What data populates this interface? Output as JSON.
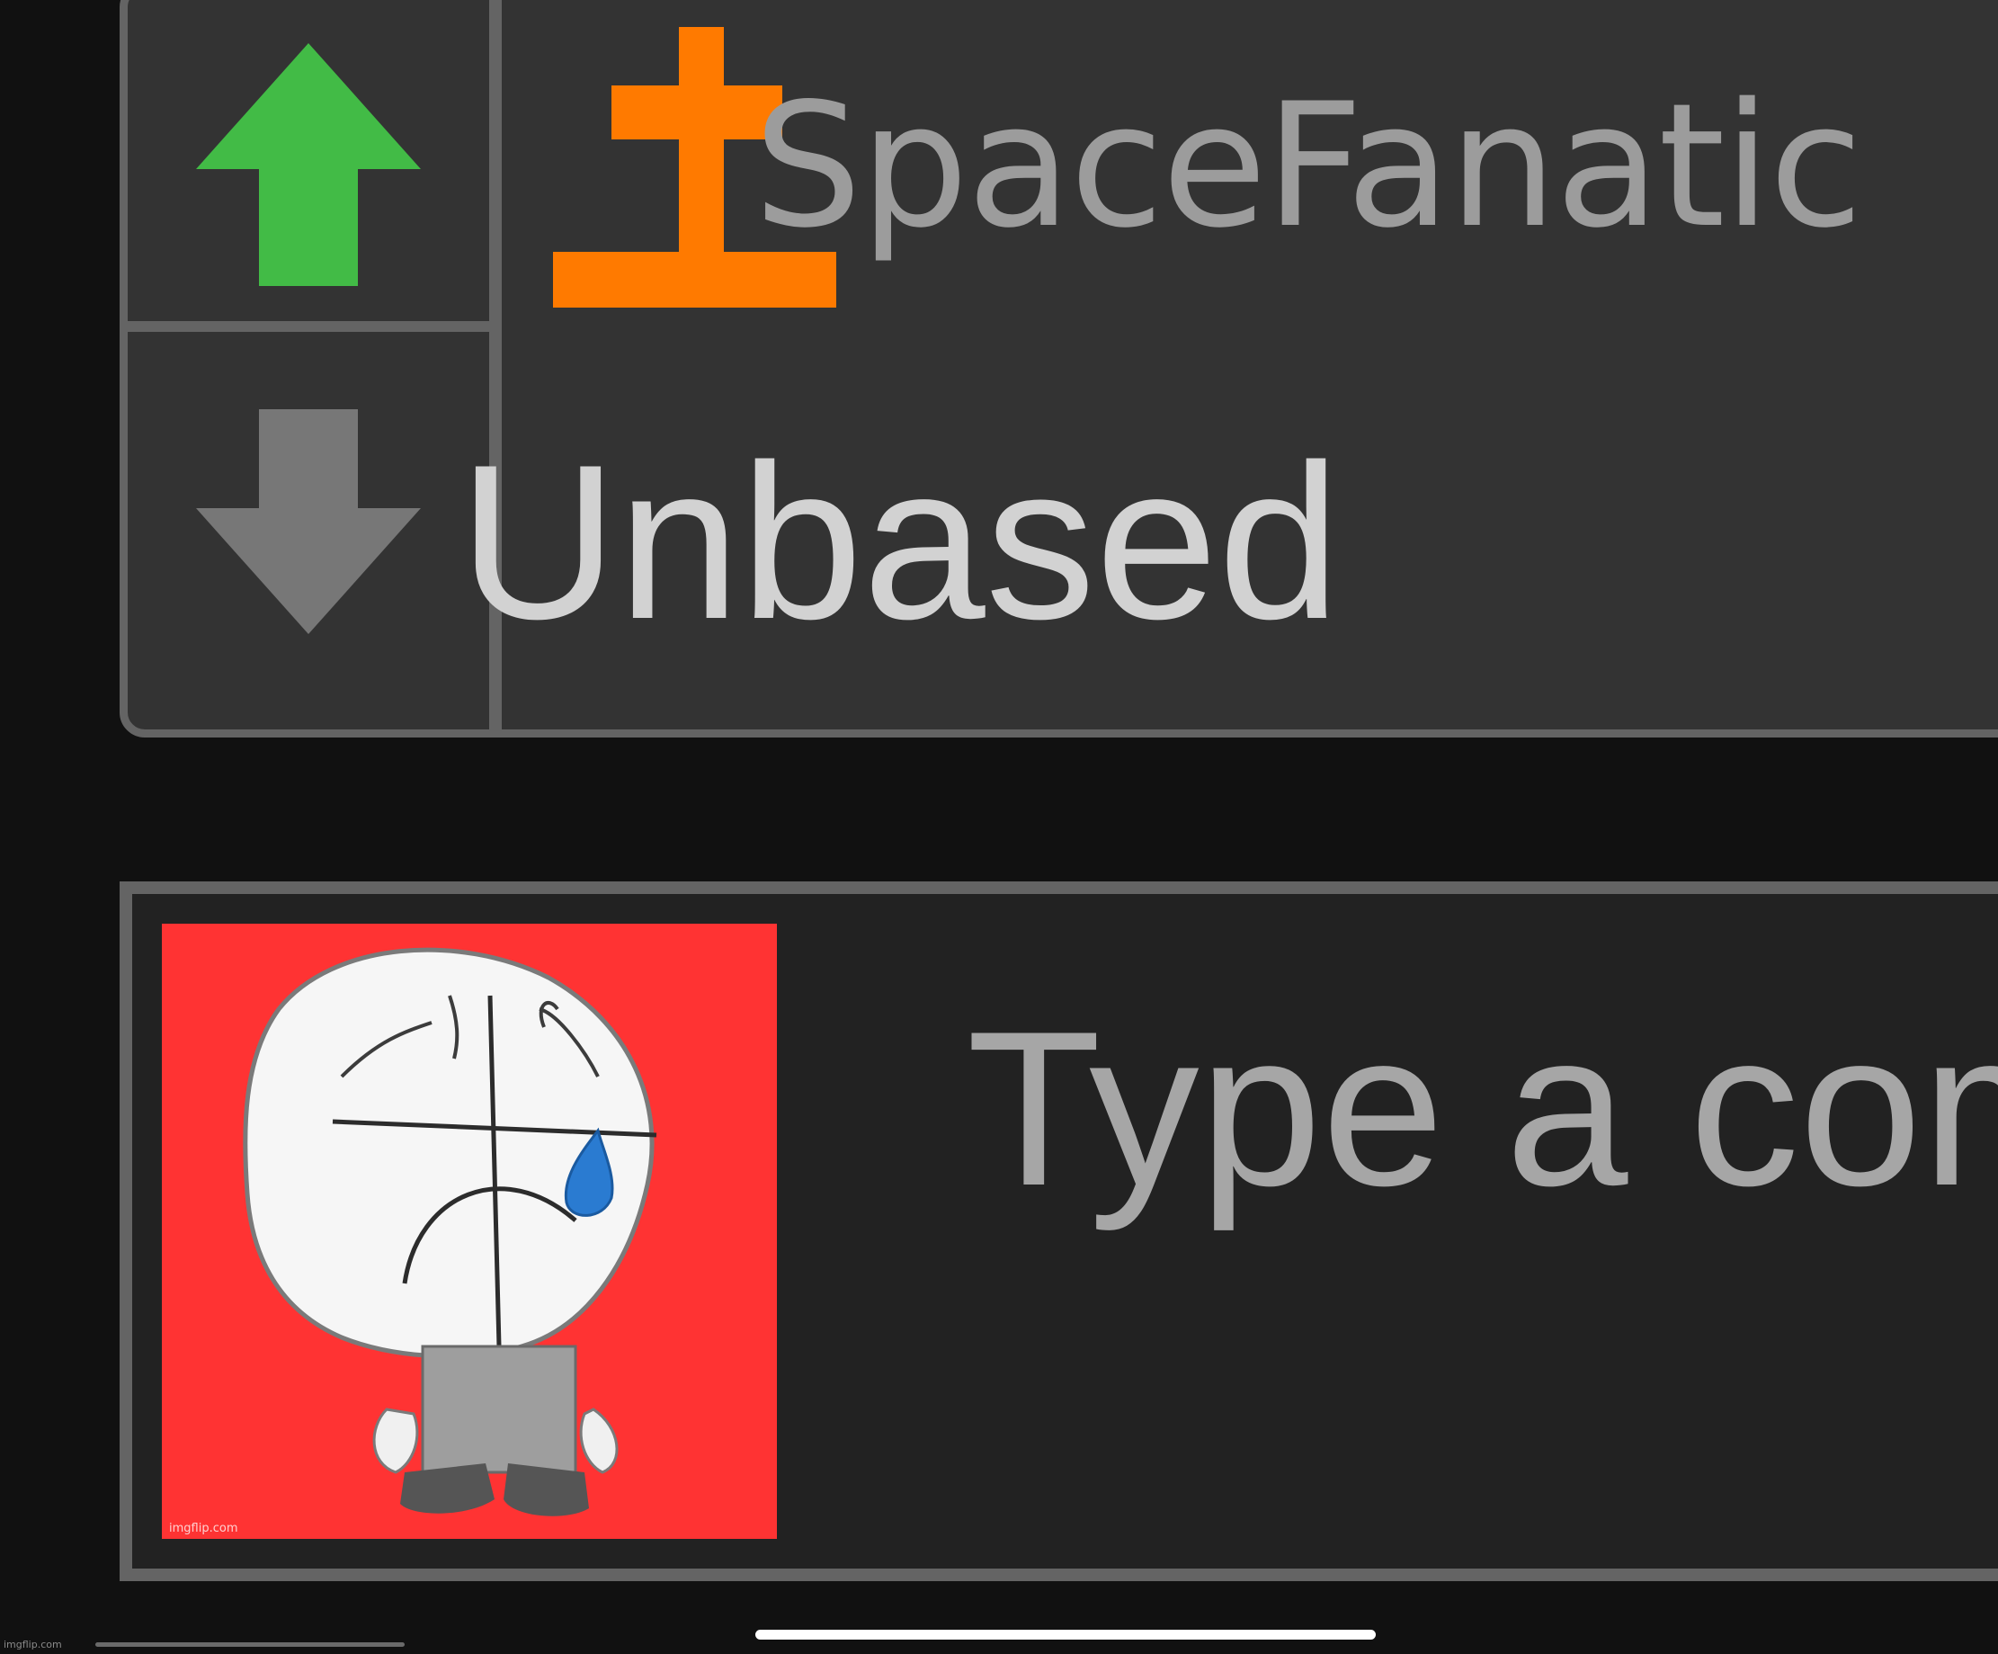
{
  "comment": {
    "username": "SpaceFanatic",
    "text": "Unbased",
    "vote_state": "upvoted"
  },
  "icons": {
    "upvote": "arrow-up-icon",
    "downvote": "arrow-down-icon",
    "user_badge": "flag-user-icon"
  },
  "colors": {
    "upvote_active": "#42bb46",
    "downvote_inactive": "#777777",
    "user_badge": "#ff7a00",
    "avatar_background": "#ff3333"
  },
  "reply": {
    "placeholder": "Type a com",
    "avatar_watermark": "imgflip.com"
  },
  "footer": {
    "watermark": "imgflip.com"
  }
}
